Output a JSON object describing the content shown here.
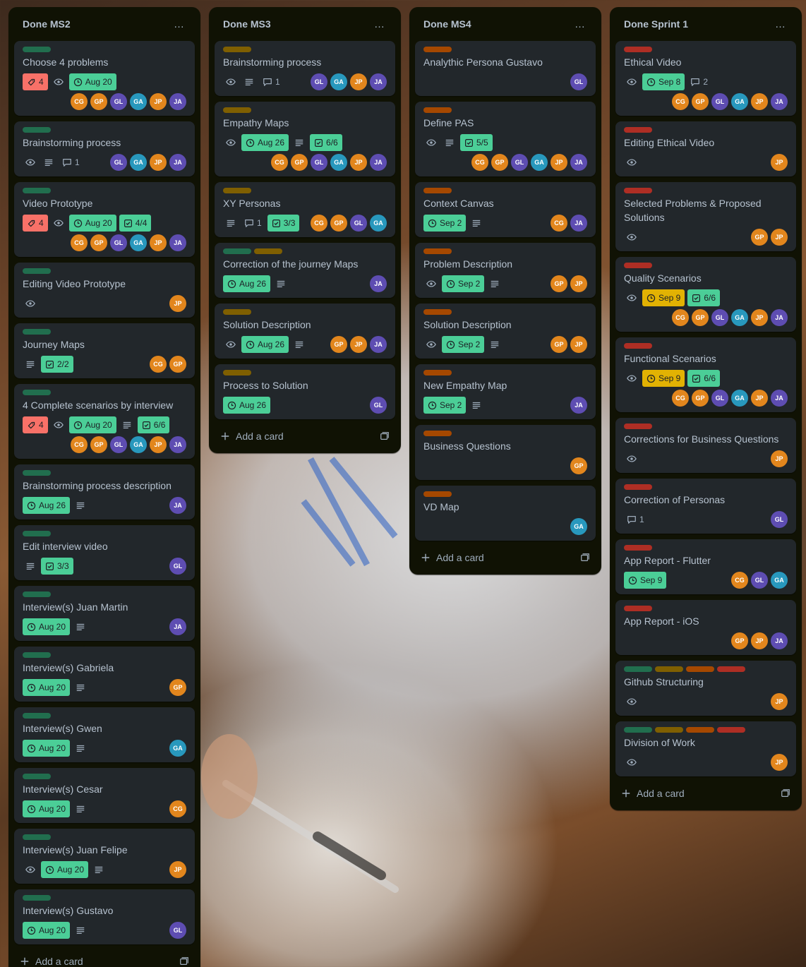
{
  "colors": {
    "list_bg": "#101204",
    "card_bg": "#22272b",
    "text": "#b6c2cf",
    "label_green": "#4bce97",
    "label_dark_green": "#216e4e",
    "label_olive": "#7f5f01",
    "label_brown": "#a54800",
    "label_red": "#ae2e24",
    "due_green": "#4bce97",
    "due_yellow": "#e2b203",
    "priority_red": "#f87168"
  },
  "add_card_label": "Add a card",
  "lists": [
    {
      "title": "Done MS2",
      "cards": [
        {
          "title": "Choose 4 problems",
          "labels": [
            "green"
          ],
          "priority": "4",
          "watch": true,
          "due": "Aug 20",
          "due_color": "green",
          "members": [
            "CG",
            "GP",
            "GL",
            "GA",
            "JP",
            "JA"
          ]
        },
        {
          "title": "Brainstorming process",
          "labels": [
            "green"
          ],
          "watch": true,
          "desc": true,
          "comments": "1",
          "members": [
            "GL",
            "GA",
            "JP",
            "JA"
          ]
        },
        {
          "title": "Video Prototype",
          "labels": [
            "green"
          ],
          "priority": "4",
          "watch": true,
          "due": "Aug 20",
          "due_color": "green",
          "checklist": "4/4",
          "members": [
            "CG",
            "GP",
            "GL",
            "GA",
            "JP",
            "JA"
          ]
        },
        {
          "title": "Editing Video Prototype",
          "labels": [
            "green"
          ],
          "watch": true,
          "members": [
            "JP"
          ]
        },
        {
          "title": "Journey Maps",
          "labels": [
            "green"
          ],
          "desc": true,
          "checklist": "2/2",
          "members": [
            "CG",
            "GP"
          ]
        },
        {
          "title": "4 Complete scenarios by interview",
          "labels": [
            "green"
          ],
          "priority": "4",
          "watch": true,
          "due": "Aug 20",
          "due_color": "green",
          "desc": true,
          "checklist": "6/6",
          "members": [
            "CG",
            "GP",
            "GL",
            "GA",
            "JP",
            "JA"
          ]
        },
        {
          "title": "Brainstorming process description",
          "labels": [
            "green"
          ],
          "due": "Aug 26",
          "due_color": "green",
          "desc": true,
          "members": [
            "JA"
          ]
        },
        {
          "title": "Edit interview video",
          "labels": [
            "green"
          ],
          "desc": true,
          "checklist": "3/3",
          "members": [
            "GL"
          ]
        },
        {
          "title": "Interview(s) Juan Martin",
          "labels": [
            "green"
          ],
          "due": "Aug 20",
          "due_color": "green",
          "desc": true,
          "members": [
            "JA"
          ]
        },
        {
          "title": "Interview(s) Gabriela",
          "labels": [
            "green"
          ],
          "due": "Aug 20",
          "due_color": "green",
          "desc": true,
          "members": [
            "GP"
          ]
        },
        {
          "title": "Interview(s) Gwen",
          "labels": [
            "green"
          ],
          "due": "Aug 20",
          "due_color": "green",
          "desc": true,
          "members": [
            "GA"
          ]
        },
        {
          "title": "Interview(s) Cesar",
          "labels": [
            "green"
          ],
          "due": "Aug 20",
          "due_color": "green",
          "desc": true,
          "members": [
            "CG"
          ]
        },
        {
          "title": "Interview(s) Juan Felipe",
          "labels": [
            "green"
          ],
          "watch": true,
          "due": "Aug 20",
          "due_color": "green",
          "desc": true,
          "members": [
            "JP"
          ]
        },
        {
          "title": "Interview(s) Gustavo",
          "labels": [
            "green"
          ],
          "due": "Aug 20",
          "due_color": "green",
          "desc": true,
          "members": [
            "GL"
          ]
        }
      ]
    },
    {
      "title": "Done MS3",
      "cards": [
        {
          "title": "Brainstorming process",
          "labels": [
            "olive"
          ],
          "watch": true,
          "desc": true,
          "comments": "1",
          "members": [
            "GL",
            "GA",
            "JP",
            "JA"
          ]
        },
        {
          "title": "Empathy Maps",
          "labels": [
            "olive"
          ],
          "watch": true,
          "due": "Aug 26",
          "due_color": "green",
          "desc": true,
          "checklist": "6/6",
          "members": [
            "CG",
            "GP",
            "GL",
            "GA",
            "JP",
            "JA"
          ]
        },
        {
          "title": "XY Personas",
          "labels": [
            "olive"
          ],
          "desc": true,
          "comments": "1",
          "checklist": "3/3",
          "members": [
            "CG",
            "GP",
            "GL",
            "GA"
          ]
        },
        {
          "title": "Correction of the journey Maps",
          "labels": [
            "dark_green",
            "olive"
          ],
          "due": "Aug 26",
          "due_color": "green",
          "desc": true,
          "members": [
            "JA"
          ]
        },
        {
          "title": "Solution Description",
          "labels": [
            "olive"
          ],
          "watch": true,
          "due": "Aug 26",
          "due_color": "green",
          "desc": true,
          "members": [
            "GP",
            "JP",
            "JA"
          ]
        },
        {
          "title": "Process to Solution",
          "labels": [
            "olive"
          ],
          "due": "Aug 26",
          "due_color": "green",
          "members": [
            "GL"
          ]
        }
      ]
    },
    {
      "title": "Done MS4",
      "cards": [
        {
          "title": "Analythic Persona Gustavo",
          "labels": [
            "brown"
          ],
          "members": [
            "GL"
          ]
        },
        {
          "title": "Define PAS",
          "labels": [
            "brown"
          ],
          "watch": true,
          "desc": true,
          "checklist": "5/5",
          "members": [
            "CG",
            "GP",
            "GL",
            "GA",
            "JP",
            "JA"
          ]
        },
        {
          "title": "Context Canvas",
          "labels": [
            "brown"
          ],
          "due": "Sep 2",
          "due_color": "green",
          "desc": true,
          "members": [
            "CG",
            "JA"
          ]
        },
        {
          "title": "Problem Description",
          "labels": [
            "brown"
          ],
          "watch": true,
          "due": "Sep 2",
          "due_color": "green",
          "desc": true,
          "members": [
            "GP",
            "JP"
          ]
        },
        {
          "title": "Solution Description",
          "labels": [
            "brown"
          ],
          "watch": true,
          "due": "Sep 2",
          "due_color": "green",
          "desc": true,
          "members": [
            "GP",
            "JP"
          ]
        },
        {
          "title": "New Empathy Map",
          "labels": [
            "brown"
          ],
          "due": "Sep 2",
          "due_color": "green",
          "desc": true,
          "members": [
            "JA"
          ]
        },
        {
          "title": "Business Questions",
          "labels": [
            "brown"
          ],
          "members": [
            "GP"
          ]
        },
        {
          "title": "VD Map",
          "labels": [
            "brown"
          ],
          "members": [
            "GA"
          ]
        }
      ]
    },
    {
      "title": "Done Sprint 1",
      "cards": [
        {
          "title": "Ethical Video",
          "labels": [
            "red"
          ],
          "watch": true,
          "due": "Sep 8",
          "due_color": "green",
          "comments": "2",
          "members": [
            "CG",
            "GP",
            "GL",
            "GA",
            "JP",
            "JA"
          ]
        },
        {
          "title": "Editing Ethical Video",
          "labels": [
            "red"
          ],
          "watch": true,
          "members": [
            "JP"
          ]
        },
        {
          "title": "Selected Problems & Proposed Solutions",
          "labels": [
            "red"
          ],
          "watch": true,
          "members": [
            "GP",
            "JP"
          ]
        },
        {
          "title": "Quality Scenarios",
          "labels": [
            "red"
          ],
          "watch": true,
          "due": "Sep 9",
          "due_color": "yellow",
          "checklist": "6/6",
          "members": [
            "CG",
            "GP",
            "GL",
            "GA",
            "JP",
            "JA"
          ]
        },
        {
          "title": "Functional Scenarios",
          "labels": [
            "red"
          ],
          "watch": true,
          "due": "Sep 9",
          "due_color": "yellow",
          "checklist": "6/6",
          "members": [
            "CG",
            "GP",
            "GL",
            "GA",
            "JP",
            "JA"
          ]
        },
        {
          "title": "Corrections for Business Questions",
          "labels": [
            "red"
          ],
          "watch": true,
          "members": [
            "JP"
          ]
        },
        {
          "title": "Correction of Personas",
          "labels": [
            "red"
          ],
          "comments": "1",
          "members": [
            "GL"
          ]
        },
        {
          "title": "App Report - Flutter",
          "labels": [
            "red"
          ],
          "due": "Sep 9",
          "due_color": "green",
          "members": [
            "CG",
            "GL",
            "GA"
          ]
        },
        {
          "title": "App Report - iOS",
          "labels": [
            "red"
          ],
          "members": [
            "GP",
            "JP",
            "JA"
          ]
        },
        {
          "title": "Github Structuring",
          "labels": [
            "dark_green",
            "olive",
            "brown",
            "red"
          ],
          "watch": true,
          "members": [
            "JP"
          ]
        },
        {
          "title": "Division of Work",
          "labels": [
            "dark_green",
            "olive",
            "brown",
            "red"
          ],
          "watch": true,
          "members": [
            "JP"
          ]
        }
      ]
    }
  ]
}
